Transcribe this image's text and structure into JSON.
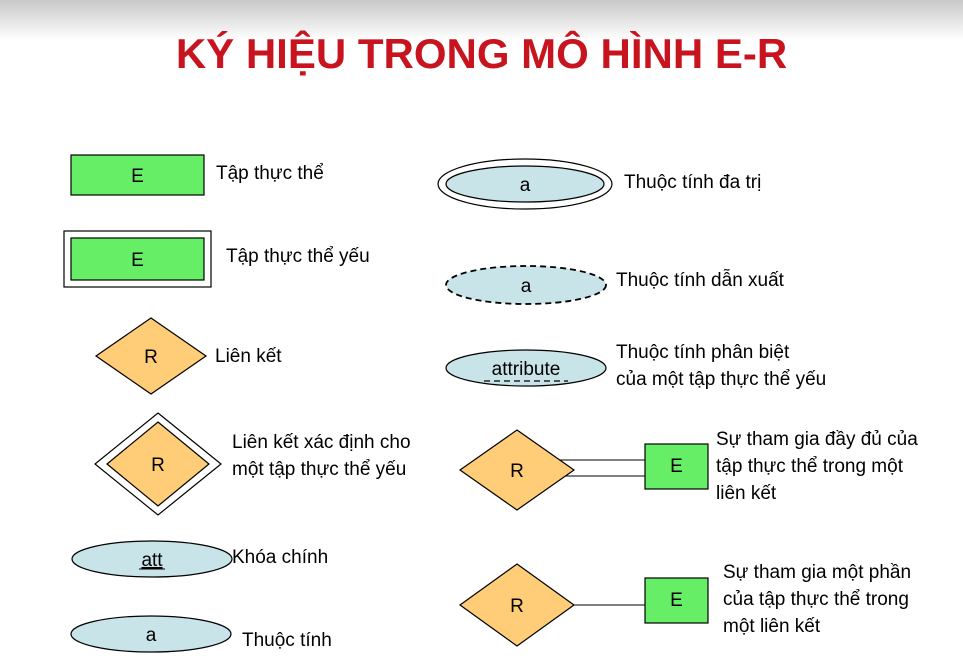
{
  "title": "KÝ HIỆU TRONG MÔ HÌNH E-R",
  "colors": {
    "title": "#c8141e",
    "entity_fill": "#66ee66",
    "relation_fill": "#ffcc77",
    "attribute_fill": "#c8e4e8"
  },
  "symbols": {
    "entity": {
      "symbol": "E",
      "desc": [
        "Tập thực thể"
      ]
    },
    "weak_entity": {
      "symbol": "E",
      "desc": [
        "Tập thực thể yếu"
      ]
    },
    "relationship": {
      "symbol": "R",
      "desc": [
        "Liên kết"
      ]
    },
    "identifying_relationship": {
      "symbol": "R",
      "desc": [
        "Liên kết xác định cho",
        "một tập thực thể  yếu"
      ]
    },
    "key_attribute": {
      "symbol": "att",
      "desc": [
        "Khóa chính"
      ]
    },
    "attribute": {
      "symbol": "a",
      "desc": [
        "Thuộc tính"
      ]
    },
    "multivalued_attribute": {
      "symbol": "a",
      "desc": [
        "Thuộc tính đa trị"
      ]
    },
    "derived_attribute": {
      "symbol": "a",
      "desc": [
        "Thuộc tính dẫn xuất"
      ]
    },
    "partial_key_attribute": {
      "symbol": "attribute",
      "desc": [
        "Thuộc tính phân biệt",
        "của một tập thực thể yếu"
      ]
    },
    "total_participation": {
      "relation": "R",
      "entity": "E",
      "desc": [
        "Sự tham gia đầy đủ của",
        "tập thực thể trong một",
        "liên kết"
      ]
    },
    "partial_participation": {
      "relation": "R",
      "entity": "E",
      "desc": [
        "Sự tham gia một phần",
        "của tập thực thể trong",
        "một liên kết"
      ]
    }
  }
}
